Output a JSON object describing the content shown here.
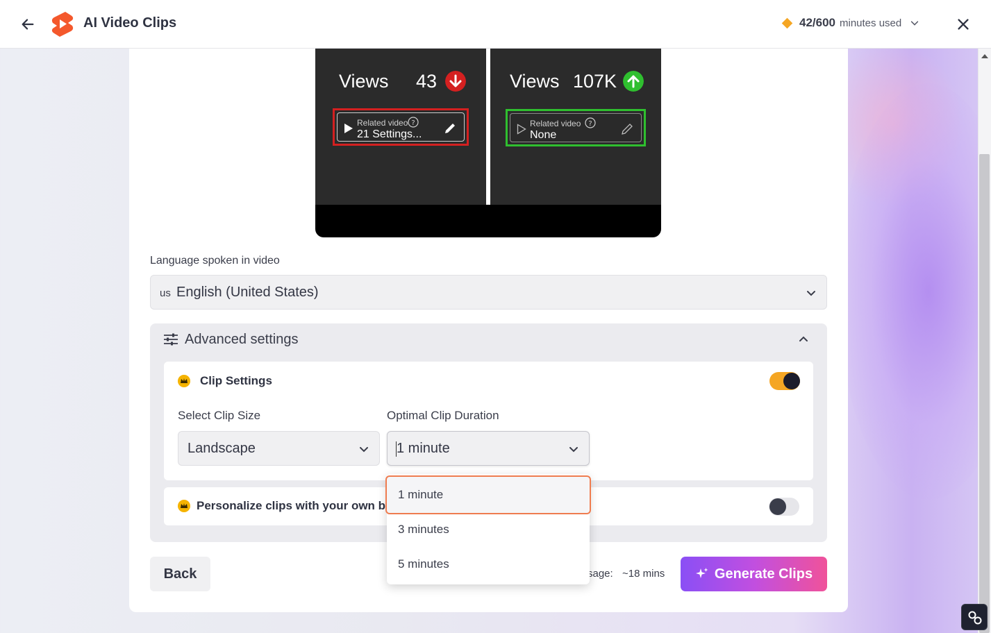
{
  "header": {
    "title": "AI Video Clips",
    "usage_count": "42/600",
    "usage_label": "minutes used"
  },
  "preview": {
    "left": {
      "views_label": "Views",
      "views_value": "43",
      "related_label": "Related video",
      "related_value": "21 Settings..."
    },
    "right": {
      "views_label": "Views",
      "views_value": "107K",
      "related_label": "Related video",
      "related_value": "None"
    }
  },
  "language": {
    "label": "Language spoken in video",
    "flag": "us",
    "value": "English (United States)"
  },
  "advanced": {
    "title": "Advanced settings",
    "clip_settings": {
      "title": "Clip Settings",
      "toggle_on": true,
      "clip_size_label": "Select Clip Size",
      "clip_size_value": "Landscape",
      "duration_label": "Optimal Clip Duration",
      "duration_value": "1 minute",
      "duration_options": [
        "1 minute",
        "3 minutes",
        "5 minutes"
      ]
    },
    "personalize": {
      "title": "Personalize clips with your own b",
      "toggle_on": false
    }
  },
  "footer": {
    "back_label": "Back",
    "estimate_label": "sage:",
    "estimate_value": "~18 mins",
    "generate_label": "Generate Clips"
  },
  "colors": {
    "accent_orange": "#f5a623",
    "generate_gradient_start": "#8a4ff5",
    "generate_gradient_end": "#f0529a",
    "dropdown_highlight": "#ef7c4f",
    "bad_red": "#d42020",
    "good_green": "#2fbf2f"
  }
}
